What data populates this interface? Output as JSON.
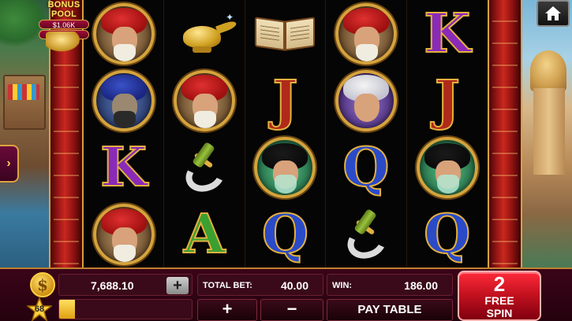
{
  "bonus_pool": {
    "title": "BONUS POOL",
    "amount": "$1.06K",
    "progress": "10/5000"
  },
  "reels": [
    [
      "vizier",
      "magician",
      "K",
      "vizier"
    ],
    [
      "lamp",
      "vizier",
      "sword",
      "A"
    ],
    [
      "book",
      "J",
      "princess",
      "Q"
    ],
    [
      "vizier",
      "prince",
      "Q",
      "sword"
    ],
    [
      "K",
      "J",
      "princess",
      "Q"
    ]
  ],
  "balance": {
    "value": "7,688.10",
    "add_label": "+"
  },
  "level": {
    "value": "68",
    "progress": 0.12
  },
  "total_bet": {
    "label": "TOTAL BET:",
    "value": "40.00"
  },
  "win": {
    "label": "WIN:",
    "value": "186.00"
  },
  "controls": {
    "bet_plus": "+",
    "bet_minus": "−",
    "paytable": "PAY TABLE"
  },
  "spin": {
    "count": "2",
    "line1": "FREE",
    "line2": "SPIN"
  },
  "colors": {
    "accent_gold": "#e0a040",
    "panel_maroon": "#3a0a1a",
    "spin_red": "#c0101e"
  },
  "icons": {
    "home": "home-icon",
    "side_tab": "chevron-right-icon",
    "coin": "dollar-coin-icon",
    "level": "star-icon"
  }
}
